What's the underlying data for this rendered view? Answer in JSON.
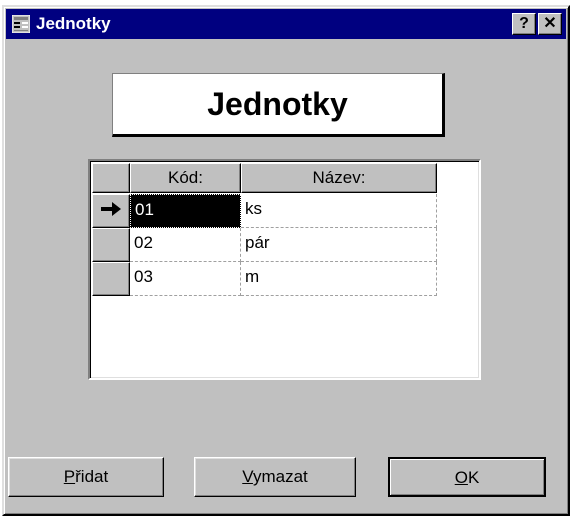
{
  "window": {
    "title": "Jednotky",
    "help_button": "?",
    "close_button": "✕"
  },
  "heading": "Jednotky",
  "grid": {
    "columns": [
      "Kód:",
      "Název:"
    ],
    "rows": [
      {
        "code": "01",
        "name": "ks",
        "current": true
      },
      {
        "code": "02",
        "name": "pár",
        "current": false
      },
      {
        "code": "03",
        "name": "m",
        "current": false
      }
    ]
  },
  "buttons": {
    "add": {
      "accel": "P",
      "rest": "řidat"
    },
    "delete": {
      "accel": "V",
      "rest": "ymazat"
    },
    "ok": {
      "accel": "O",
      "rest": "K"
    }
  },
  "colors": {
    "titlebar": "#000080",
    "face": "#c0c0c0",
    "selection": "#000000"
  }
}
